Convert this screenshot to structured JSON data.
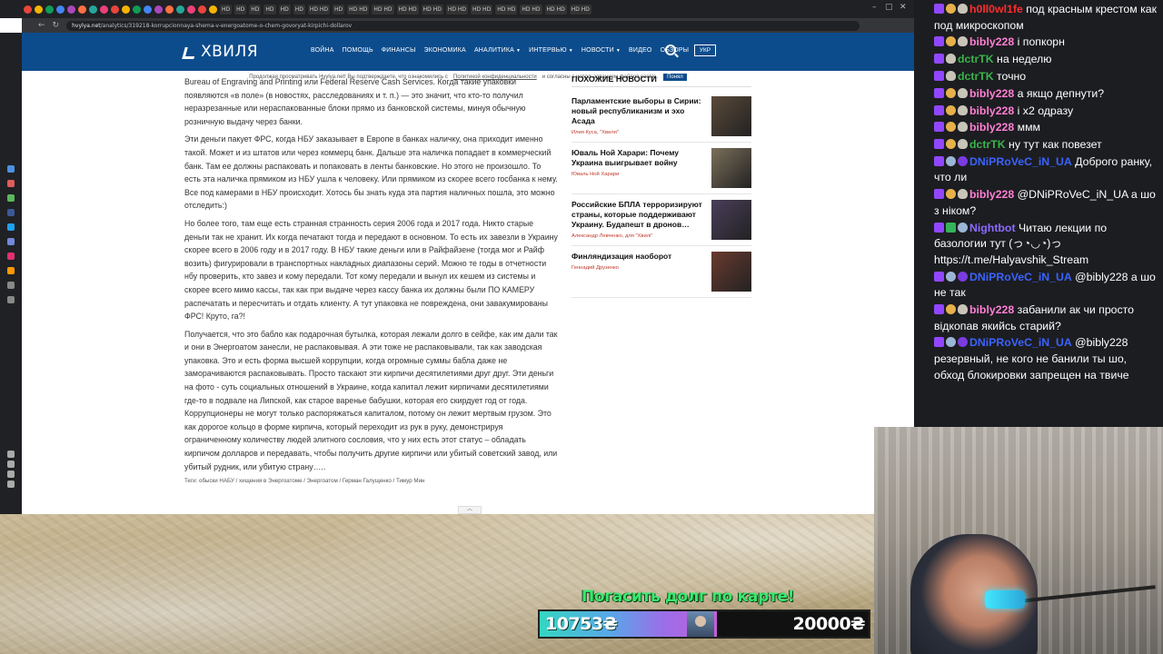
{
  "browser": {
    "tab_labels": [
      "HD",
      "HD",
      "HD",
      "HD",
      "HD",
      "HD",
      "HD HD",
      "HD",
      "HD HD",
      "HD HD",
      "HD HD",
      "HD HD",
      "HD HD",
      "HD HD",
      "HD HD",
      "HD HD",
      "HD HD",
      "HD HD"
    ],
    "url_host": "hvylya.net",
    "url_path": "/analytics/319218-korrupcionnaya-shema-v-energoatome-o-chem-govoryat-kirpichi-dollarov"
  },
  "site": {
    "logo": "ХВИЛЯ",
    "nav": [
      {
        "label": "ВОЙНА",
        "dropdown": false
      },
      {
        "label": "ПОМОЩЬ",
        "dropdown": false
      },
      {
        "label": "ФИНАНСЫ",
        "dropdown": false
      },
      {
        "label": "ЭКОНОМИКА",
        "dropdown": false
      },
      {
        "label": "АНАЛИТИКА",
        "dropdown": true
      },
      {
        "label": "ИНТЕРВЬЮ",
        "dropdown": true
      },
      {
        "label": "НОВОСТИ",
        "dropdown": true
      },
      {
        "label": "ВИДЕО",
        "dropdown": false
      },
      {
        "label": "ОБЗОРЫ",
        "dropdown": false
      }
    ],
    "lang": "УКР",
    "cookie_text": "Продолжая просматривать Hvylya.net! Вы подтверждаете, что ознакомились с",
    "cookie_link": "Политикой конфиденциальности",
    "cookie_text2": "и согласны с использованием файлов cookie.",
    "cookie_accept": "Понял"
  },
  "article": {
    "paragraphs": [
      "Bureau of Engraving and Printing или Federal Reserve Cash Services. Когда такие упаковки появляются «в поле» (в новостях, расследованиях и т. п.) — это значит, что кто-то получил неразрезанные или нераспакованные блоки прямо из банковской системы, минуя обычную розничную выдачу через банки.",
      "Эти деньги пакует ФРС, когда НБУ заказывает в Европе в банках наличку, она приходит именно такой. Может и из штатов или через коммерц банк. Дальше эта наличка попадает в коммерческий банк. Там ее должны распаковать и попаковать в ленты банковские. Но этого не произошло. То есть эта наличка прямиком из НБУ ушла к человеку. Или прямиком из скорее всего госбанка к нему. Все под камерами в НБУ происходит. Хотось бы знать куда эта партия наличных пошла, это можно отследить:)",
      "Но более того, там еще есть странная странность серия 2006 года и 2017 года. Никто старые деньги так не хранит. Их когда печатают тогда и передают в основном. То есть их завезли в Украину скорее всего в 2006 году и в 2017 году. В НБУ такие деньги или в Райфайзене (тогда мог и Райф возить) фигурировали в транспортных накладных диапазоны серий. Можно те годы в отчетности нбу проверить, кто завез и кому передали. Тот кому передали и вынул их кешем из системы и скорее всего мимо кассы, так как при выдаче через кассу банка их должны были ПО КАМЕРУ распечатать и пересчитать и отдать клиенту. А тут упаковка не повреждена, они завакумированы ФРС! Круто, га?!",
      "Получается, что это бабло как подарочная бутылка, которая лежали долго в сейфе, как им дали так и они в Энергоатом занесли, не распаковывая. А эти тоже не распаковывали, так как заводская упаковка. Это и есть форма высшей коррупции, когда огромные суммы бабла даже не заморачиваются распаковывать. Просто таскают эти кирпичи десятилетиями друг друг. Эти деньги на фото - суть социальных отношений в Украине, когда капитал лежит кирпичами десятилетиями где-то в подвале на Липской, как старое варенье бабушки, которая его скирдует год от года. Коррупционеры не могут только распоряжаться капиталом, потому он лежит мертвым грузом. Это как дорогое кольцо в форме кирпича, который переходит из рук в руку, демонстрируя ограниченному количеству людей элитного сословия, что у них есть этот статус – обладать кирпичом долларов и передавать, чтобы получить другие кирпичи или убитый советский завод, или убитый рудник, или убитую страну….."
    ],
    "tags": "Теги: обыски НАБУ / хищения в Энергоатоме / Энергоатом / Герман Галущенко / Тимур Мин"
  },
  "sidebar": {
    "heading": "ПОХОЖИЕ НОВОСТИ",
    "news": [
      {
        "title": "Парламентские выборы в Сирии: новый республиканизм и эхо Асада",
        "author": "Илия Куса, \"Хвиля\"",
        "thumb_color": "#5a4a3a"
      },
      {
        "title": "Юваль Ной Харари: Почему Украина выигрывает войну",
        "author": "Юваль Ной Харари",
        "thumb_color": "#7b6f5a"
      },
      {
        "title": "Российские БПЛА терроризируют страны, которые поддерживают Украину. Будапешт в дронов…",
        "author": "Александр Левченко, для \"Хвилі\"",
        "thumb_color": "#4a3e5a"
      },
      {
        "title": "Финляндизация наоборот",
        "author": "Геннадий Друзенко",
        "thumb_color": "#6a3a2e"
      }
    ],
    "scroll_up": "︿"
  },
  "donation": {
    "caption": "Погасить долг по карте!",
    "current": "10753₴",
    "goal": "20000₴",
    "progress": 0.54
  },
  "chat": [
    {
      "badges": [
        "b-sub",
        "b-gold",
        "b-skull"
      ],
      "user": "h0ll0wl1fe",
      "color": "u-red",
      "text": "под красным крестом как под микроскопом"
    },
    {
      "badges": [
        "b-sub",
        "b-gold",
        "b-skull"
      ],
      "user": "bibly228",
      "color": "u-pink",
      "text": "і попкорн"
    },
    {
      "badges": [
        "b-sub",
        "b-skull"
      ],
      "user": "dctrTK",
      "color": "u-green",
      "text": "на неделю"
    },
    {
      "badges": [
        "b-sub",
        "b-skull"
      ],
      "user": "dctrTK",
      "color": "u-green",
      "text": "точно"
    },
    {
      "badges": [
        "b-sub",
        "b-gold",
        "b-skull"
      ],
      "user": "bibly228",
      "color": "u-pink",
      "text": "а якщо депнути?"
    },
    {
      "badges": [
        "b-sub",
        "b-gold",
        "b-skull"
      ],
      "user": "bibly228",
      "color": "u-pink",
      "text": "і х2 одразу"
    },
    {
      "badges": [
        "b-sub",
        "b-gold",
        "b-skull"
      ],
      "user": "bibly228",
      "color": "u-pink",
      "text": "ммм"
    },
    {
      "badges": [
        "b-sub",
        "b-gold",
        "b-skull"
      ],
      "user": "dctrTK",
      "color": "u-green",
      "text": "ну тут как повезет"
    },
    {
      "badges": [
        "b-sub",
        "b-gear",
        "b-star"
      ],
      "user": "DNiPRoVeC_iN_UA",
      "color": "u-blue",
      "text": "Доброго ранку, что ли"
    },
    {
      "badges": [
        "b-sub",
        "b-gold",
        "b-skull"
      ],
      "user": "bibly228",
      "color": "u-pink",
      "text": "@DNiPRoVeC_iN_UA а шо з ніком?"
    },
    {
      "badges": [
        "b-sub",
        "b-mod",
        "b-gear"
      ],
      "user": "Nightbot",
      "color": "u-violet",
      "text": "Читаю лекции по базологии тут (っ◔◡◔)っ https://t.me/Halyavshik_Stream"
    },
    {
      "badges": [
        "b-sub",
        "b-gear",
        "b-star"
      ],
      "user": "DNiPRoVeC_iN_UA",
      "color": "u-blue",
      "text": "@bibly228 а шо не так"
    },
    {
      "badges": [
        "b-sub",
        "b-gold",
        "b-skull"
      ],
      "user": "bibly228",
      "color": "u-pink",
      "text": "забанили ак чи просто відкопав якийсь старий?"
    },
    {
      "badges": [
        "b-sub",
        "b-gear",
        "b-star"
      ],
      "user": "DNiPRoVeC_iN_UA",
      "color": "u-blue",
      "text": "@bibly228 резервный, не кого не банили ты шо, обход блокировки запрещен на твиче"
    }
  ]
}
